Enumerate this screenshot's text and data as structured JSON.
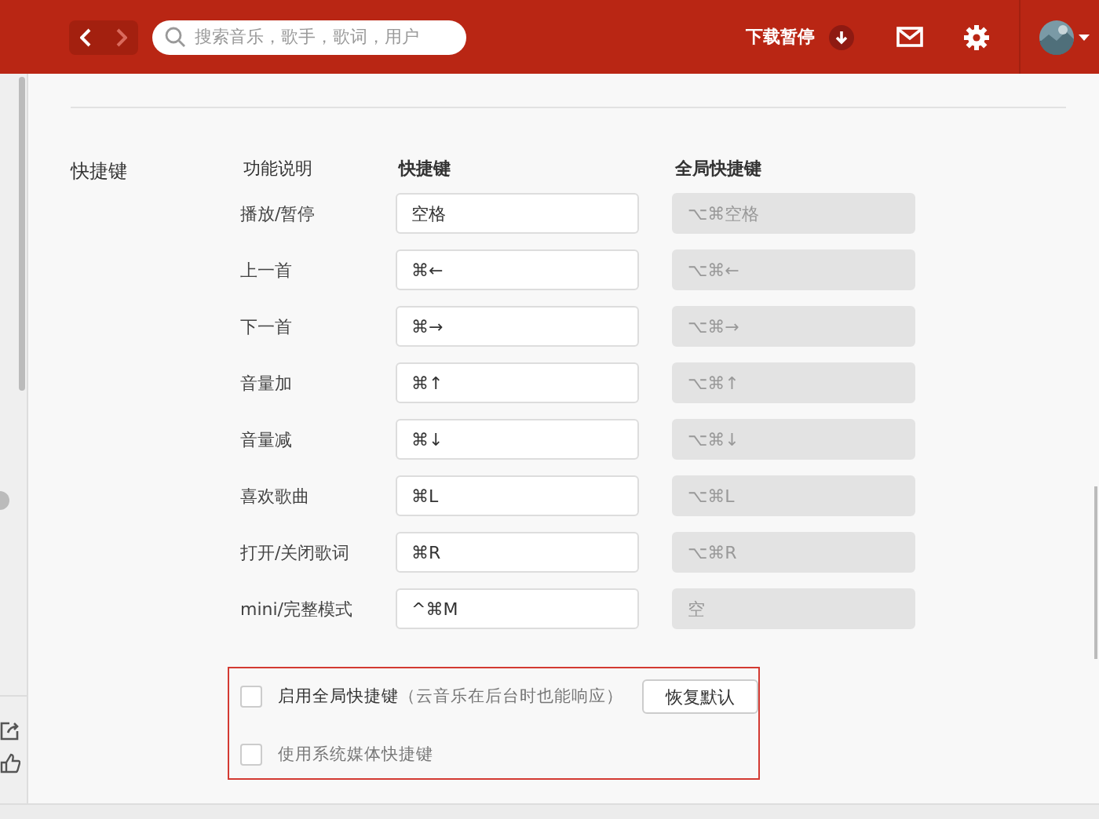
{
  "header": {
    "nav": [
      {
        "kind": "back",
        "disabled": false
      },
      {
        "kind": "forward",
        "disabled": true
      }
    ],
    "search": {
      "placeholder": "搜索音乐，歌手，歌词，用户"
    },
    "download_status": "下载暂停"
  },
  "section": {
    "title": "快捷键",
    "columns": [
      "功能说明",
      "快捷键",
      "全局快捷键"
    ],
    "rows": [
      {
        "name": "播放/暂停",
        "shortcut": "空格",
        "global": "⌥⌘空格"
      },
      {
        "name": "上一首",
        "shortcut": "⌘←",
        "global": "⌥⌘←"
      },
      {
        "name": "下一首",
        "shortcut": "⌘→",
        "global": "⌥⌘→"
      },
      {
        "name": "音量加",
        "shortcut": "⌘↑",
        "global": "⌥⌘↑"
      },
      {
        "name": "音量减",
        "shortcut": "⌘↓",
        "global": "⌥⌘↓"
      },
      {
        "name": "喜欢歌曲",
        "shortcut": "⌘L",
        "global": "⌥⌘L"
      },
      {
        "name": "打开/关闭歌词",
        "shortcut": "⌘R",
        "global": "⌥⌘R"
      },
      {
        "name": "mini/完整模式",
        "shortcut": "^⌘M",
        "global": "空"
      }
    ],
    "options": [
      {
        "label": "**启用全局快捷键**（云音乐在后台时也能响应）",
        "checked": false
      },
      {
        "label": "使用系统媒体快捷键",
        "checked": false
      }
    ],
    "reset_button": "恢复默认"
  }
}
